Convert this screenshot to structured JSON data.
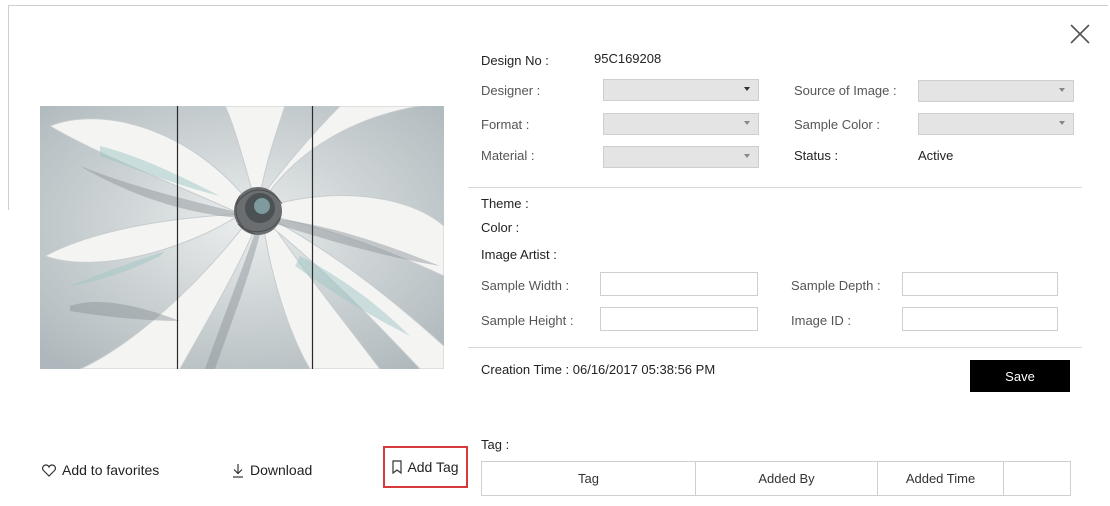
{
  "dialog": {
    "close_icon": "close-icon"
  },
  "image": {
    "alt": "painting-image"
  },
  "actions": {
    "favorites_label": "Add to favorites",
    "download_label": "Download",
    "add_tag_label": "Add Tag"
  },
  "details": {
    "design_no_label": "Design No :",
    "design_no_value": "95C169208",
    "designer_label": "Designer :",
    "source_label": "Source of Image :",
    "format_label": "Format :",
    "sample_color_label": "Sample Color :",
    "material_label": "Material :",
    "status_label": "Status :",
    "status_value": "Active",
    "theme_label": "Theme :",
    "color_label": "Color :",
    "artist_label": "Image Artist :",
    "sample_width_label": "Sample Width :",
    "sample_depth_label": "Sample Depth :",
    "sample_height_label": "Sample Height :",
    "image_id_label": "Image ID :",
    "creation_time_label": "Creation Time : 06/16/2017 05:38:56 PM",
    "save_label": "Save",
    "tag_label": "Tag :"
  },
  "tag_table": {
    "columns": [
      "Tag",
      "Added By",
      "Added Time",
      ""
    ]
  }
}
